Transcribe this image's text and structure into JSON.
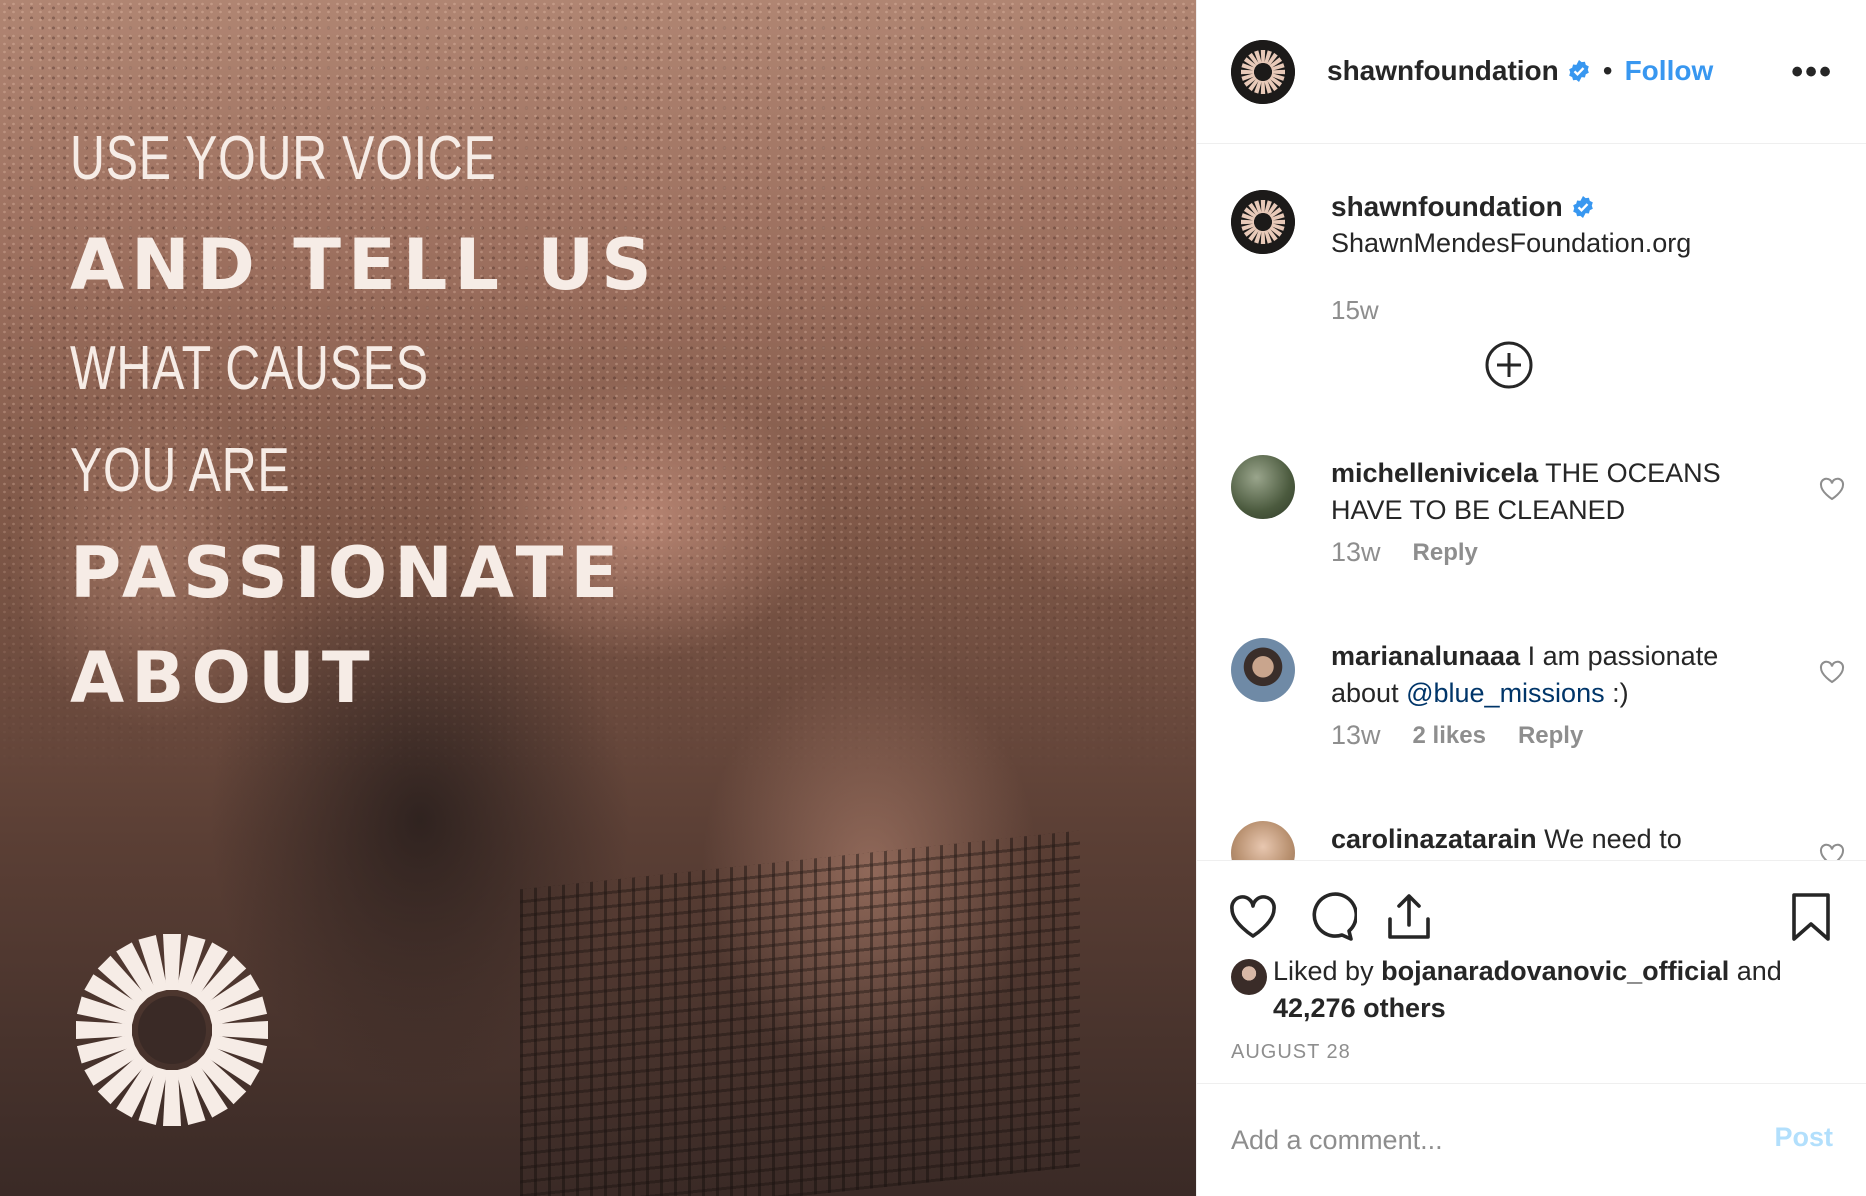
{
  "post": {
    "image_text": {
      "line1": "USE YOUR VOICE",
      "line2": "AND TELL US",
      "line3": "WHAT CAUSES",
      "line4": "YOU ARE",
      "line5": "PASSIONATE",
      "line6": "ABOUT"
    }
  },
  "header": {
    "username": "shawnfoundation",
    "separator": "•",
    "follow_label": "Follow",
    "more_label": "•••"
  },
  "caption": {
    "username": "shawnfoundation",
    "text": "ShawnMendesFoundation.org",
    "time": "15w"
  },
  "comments": [
    {
      "username": "michellenivicela",
      "text": "THE OCEANS HAVE TO BE CLEANED",
      "time": "13w",
      "likes": "",
      "reply_label": "Reply"
    },
    {
      "username": "marianalunaaa",
      "text": "I am passionate about",
      "mention": "@blue_missions",
      "text_after": " :)",
      "time": "13w",
      "likes": "2 likes",
      "reply_label": "Reply"
    },
    {
      "username": "carolinazatarain",
      "text": "We need to change"
    }
  ],
  "likes": {
    "prefix": "Liked by",
    "user": "bojanaradovanovic_official",
    "and": "and",
    "count": "42,276 others"
  },
  "date": "AUGUST 28",
  "add_comment": {
    "placeholder": "Add a comment...",
    "post_label": "Post"
  },
  "colors": {
    "follow": "#3897f0",
    "verified": "#3897f0",
    "post_disabled": "#b2dffc",
    "muted": "#8e8e8e",
    "mention": "#003569"
  },
  "icons": [
    "verified-badge-icon",
    "more-options-icon",
    "view-replies-plus-icon",
    "comment-like-heart-icon",
    "like-heart-icon",
    "comment-bubble-icon",
    "share-icon",
    "save-bookmark-icon",
    "foundation-logo-icon"
  ]
}
